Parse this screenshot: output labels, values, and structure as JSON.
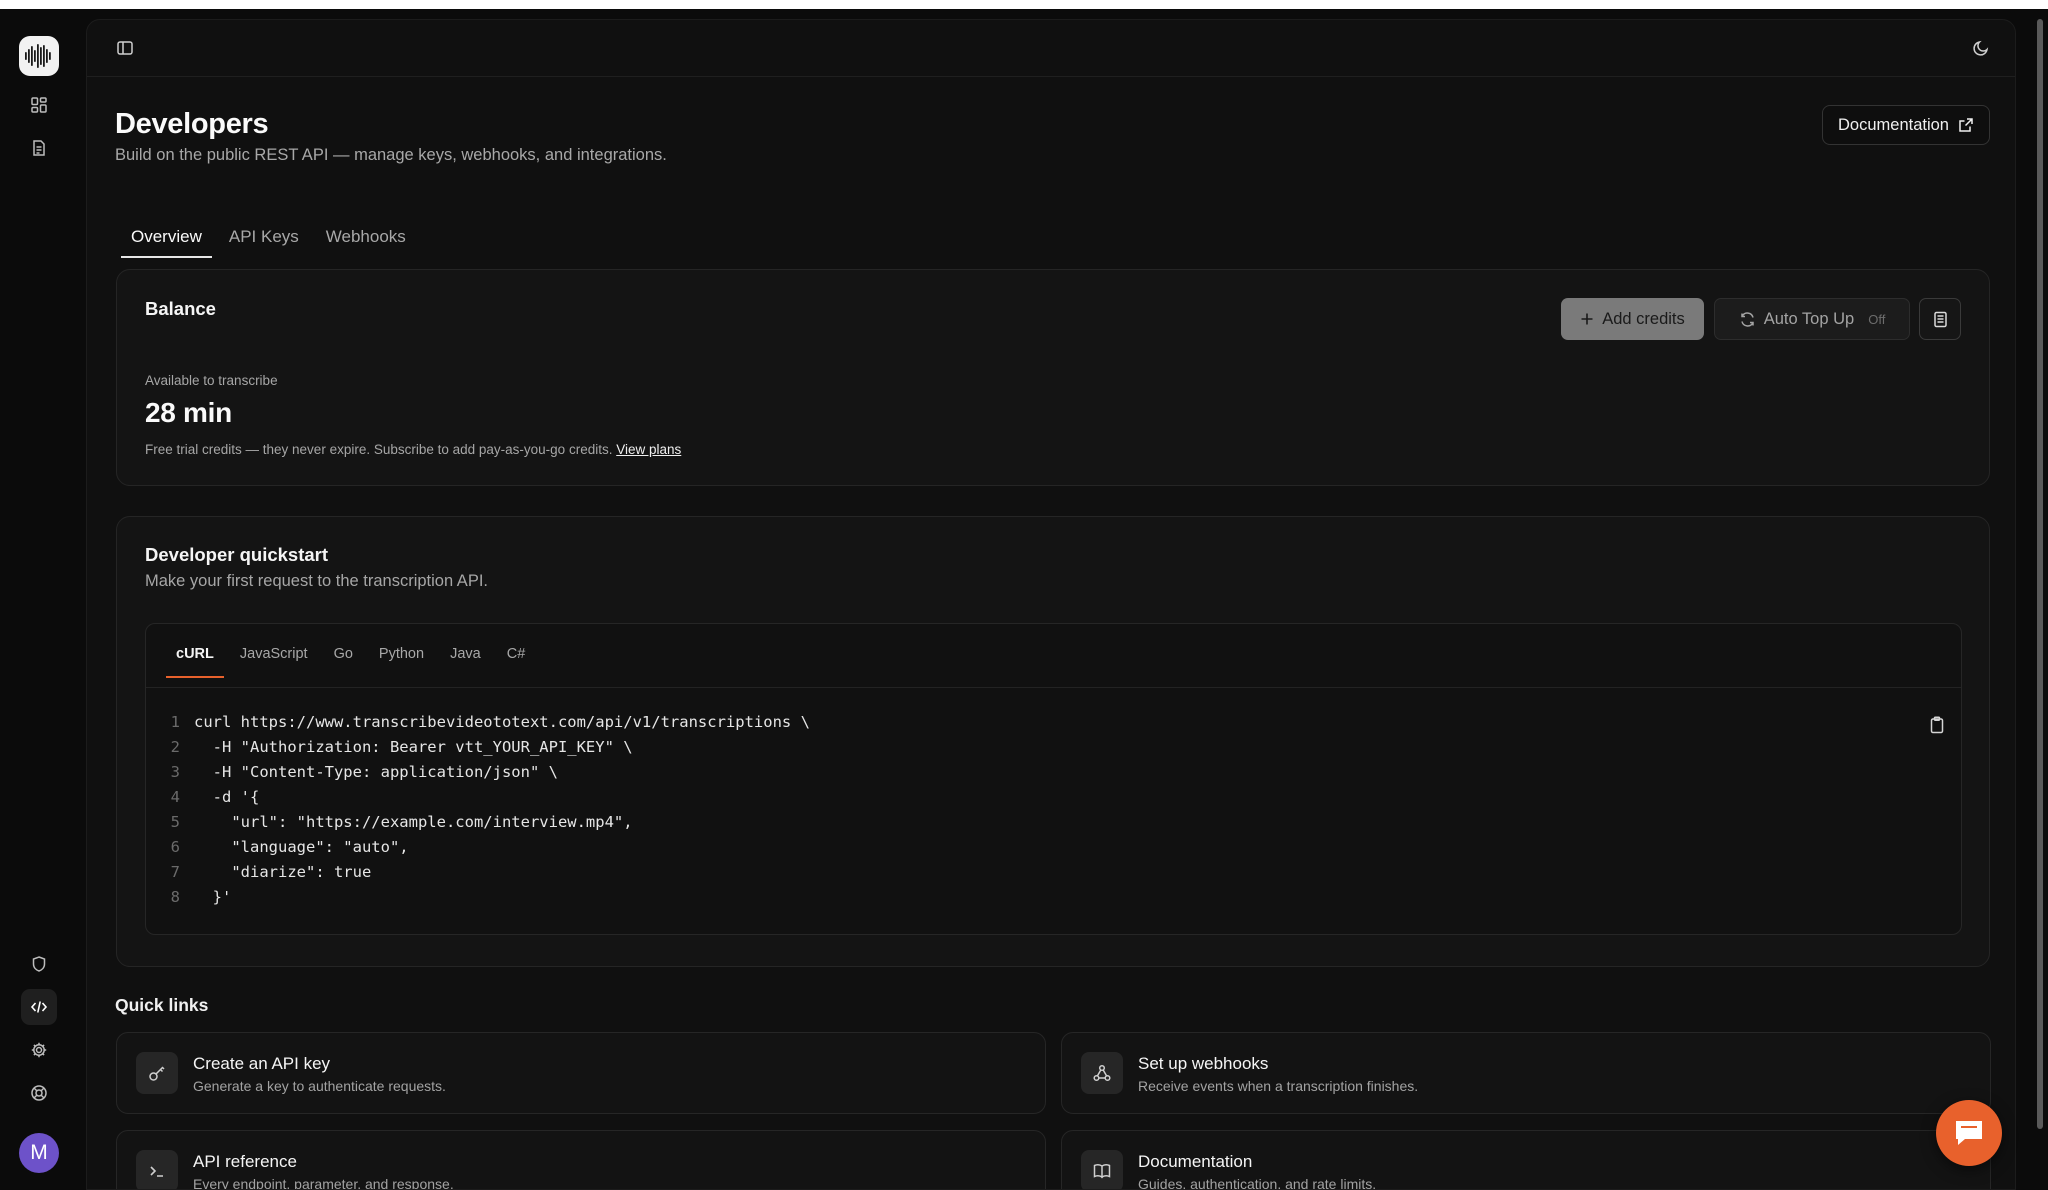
{
  "header": {
    "title": "Developers",
    "subtitle": "Build on the public REST API — manage keys, webhooks, and integrations.",
    "doc_button": "Documentation"
  },
  "tabs": [
    {
      "label": "Overview",
      "active": true
    },
    {
      "label": "API Keys",
      "active": false
    },
    {
      "label": "Webhooks",
      "active": false
    }
  ],
  "balance": {
    "title": "Balance",
    "add_credits": "Add credits",
    "auto_top_up": "Auto Top Up",
    "auto_top_up_state": "Off",
    "available_label": "Available to transcribe",
    "amount": "28 min",
    "note": "Free trial credits — they never expire. Subscribe to add pay-as-you-go credits.",
    "view_plans": "View plans"
  },
  "quickstart": {
    "title": "Developer quickstart",
    "subtitle": "Make your first request to the transcription API.",
    "languages": [
      {
        "label": "cURL",
        "active": true
      },
      {
        "label": "JavaScript",
        "active": false
      },
      {
        "label": "Go",
        "active": false
      },
      {
        "label": "Python",
        "active": false
      },
      {
        "label": "Java",
        "active": false
      },
      {
        "label": "C#",
        "active": false
      }
    ],
    "code_lines": [
      {
        "n": "1",
        "text": "curl https://www.transcribevideototext.com/api/v1/transcriptions \\"
      },
      {
        "n": "2",
        "text": "  -H \"Authorization: Bearer vtt_YOUR_API_KEY\" \\"
      },
      {
        "n": "3",
        "text": "  -H \"Content-Type: application/json\" \\"
      },
      {
        "n": "4",
        "text": "  -d '{"
      },
      {
        "n": "5",
        "text": "    \"url\": \"https://example.com/interview.mp4\","
      },
      {
        "n": "6",
        "text": "    \"language\": \"auto\","
      },
      {
        "n": "7",
        "text": "    \"diarize\": true"
      },
      {
        "n": "8",
        "text": "  }'"
      }
    ]
  },
  "quick_links": {
    "title": "Quick links",
    "items": [
      {
        "name": "Create an API key",
        "desc": "Generate a key to authenticate requests.",
        "icon": "key-icon"
      },
      {
        "name": "Set up webhooks",
        "desc": "Receive events when a transcription finishes.",
        "icon": "webhook-icon"
      },
      {
        "name": "API reference",
        "desc": "Every endpoint, parameter, and response.",
        "icon": "terminal-icon"
      },
      {
        "name": "Documentation",
        "desc": "Guides, authentication, and rate limits.",
        "icon": "book-icon"
      }
    ]
  },
  "colors": {
    "accent": "#e8612c",
    "avatar": "#6d52c9"
  },
  "user": {
    "initial": "M"
  }
}
